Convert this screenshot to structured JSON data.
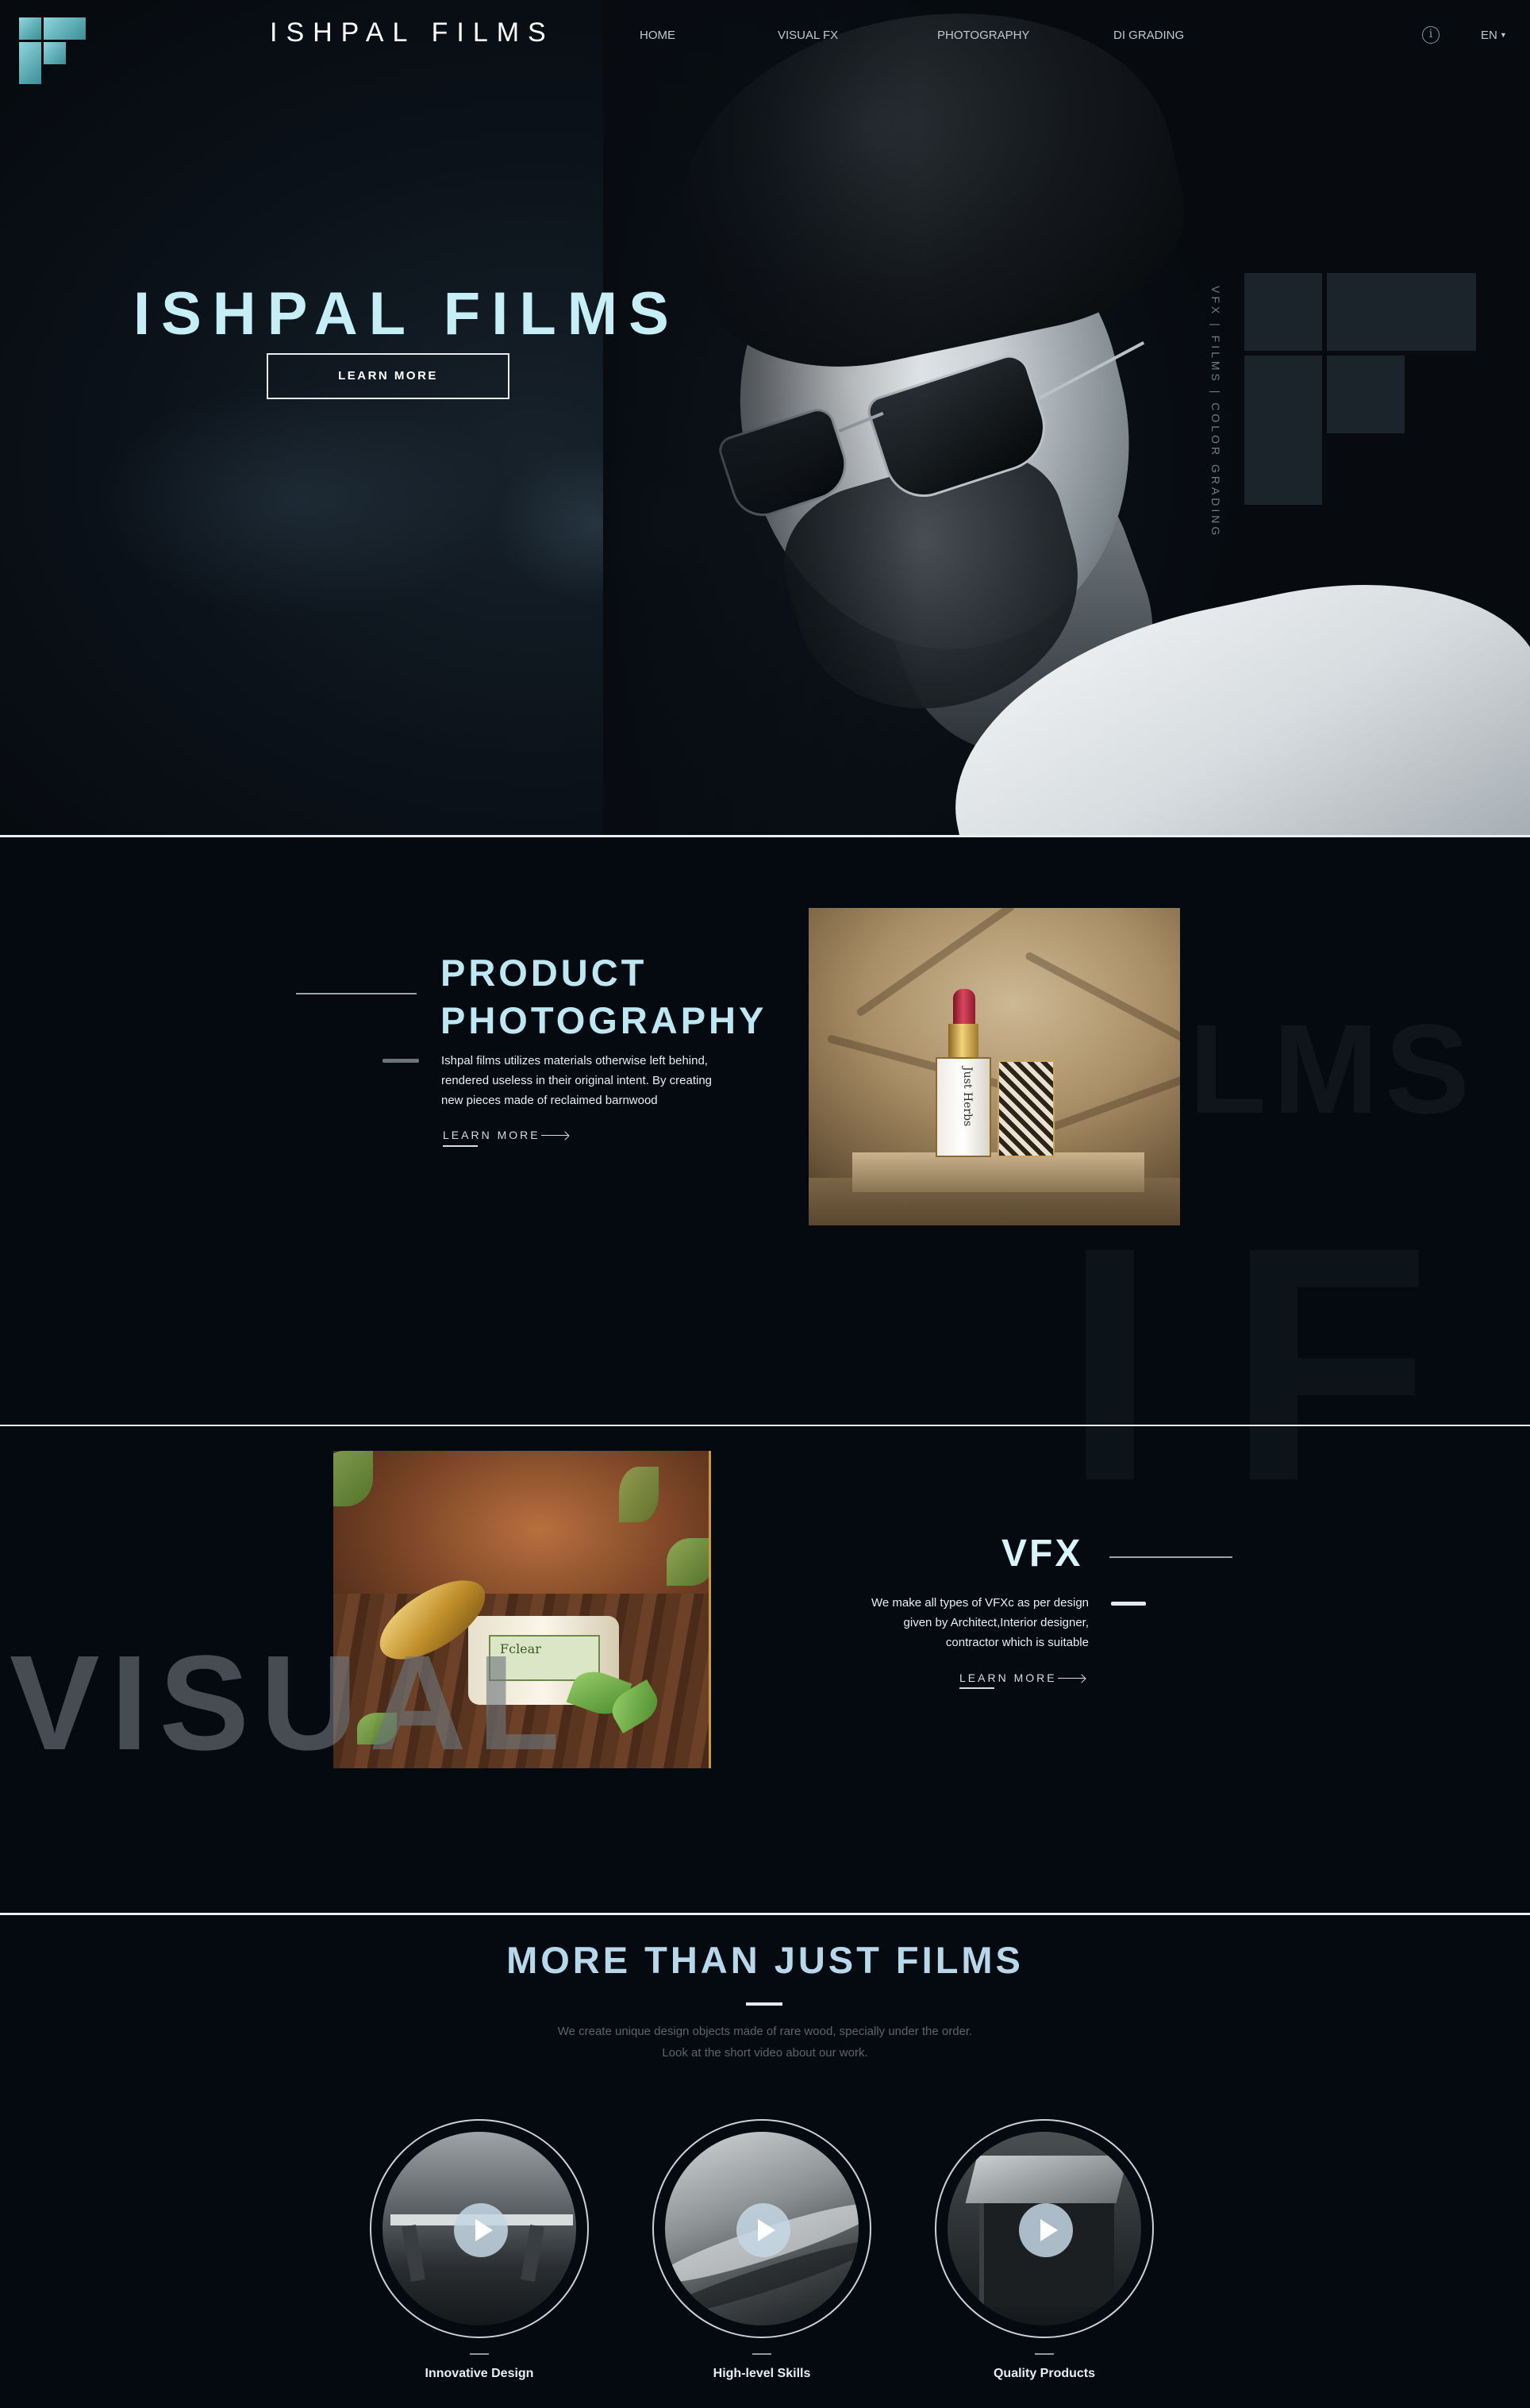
{
  "header": {
    "brand": "ISHPAL FILMS",
    "nav": [
      "HOME",
      "VISUAL FX",
      "PHOTOGRAPHY",
      "DI GRADING"
    ],
    "info_icon": "info-icon",
    "language": "EN",
    "logo_icon": "if-logo-mark"
  },
  "hero": {
    "heading": "ISHPAL FILMS",
    "button": "LEARN MORE",
    "side_text": "VFX | FILMS | COLOR GRADING"
  },
  "photography": {
    "heading_line1": "PRODUCT",
    "heading_line2": "PHOTOGRAPHY",
    "description": "Ishpal films utilizes materials otherwise left behind, rendered useless in their original intent. By creating new pieces made of reclaimed barnwood",
    "link": "LEARN MORE",
    "watermark_films": "FILMS",
    "watermark_if": "IF",
    "image_box_text": "Just Herbs"
  },
  "vfx": {
    "heading": "VFX",
    "description": "We make all types of VFXc as per design given by Architect,Interior designer, contractor which is suitable",
    "link": "LEARN MORE",
    "watermark": "VISUAL",
    "image_jar_text": "Fclear"
  },
  "more": {
    "heading": "MORE THAN JUST FILMS",
    "sub_line1": "We create unique design objects made of rare wood, specially under the order.",
    "sub_line2": "Look at the short video about our work.",
    "cards": [
      {
        "label": "Innovative Design"
      },
      {
        "label": "High-level Skills"
      },
      {
        "label": "Quality Products"
      }
    ]
  },
  "colors": {
    "background": "#050a10",
    "accent_cyan": "#c6eef6",
    "heading_blue": "#b7d8ea",
    "muted_text": "#5a656b"
  }
}
